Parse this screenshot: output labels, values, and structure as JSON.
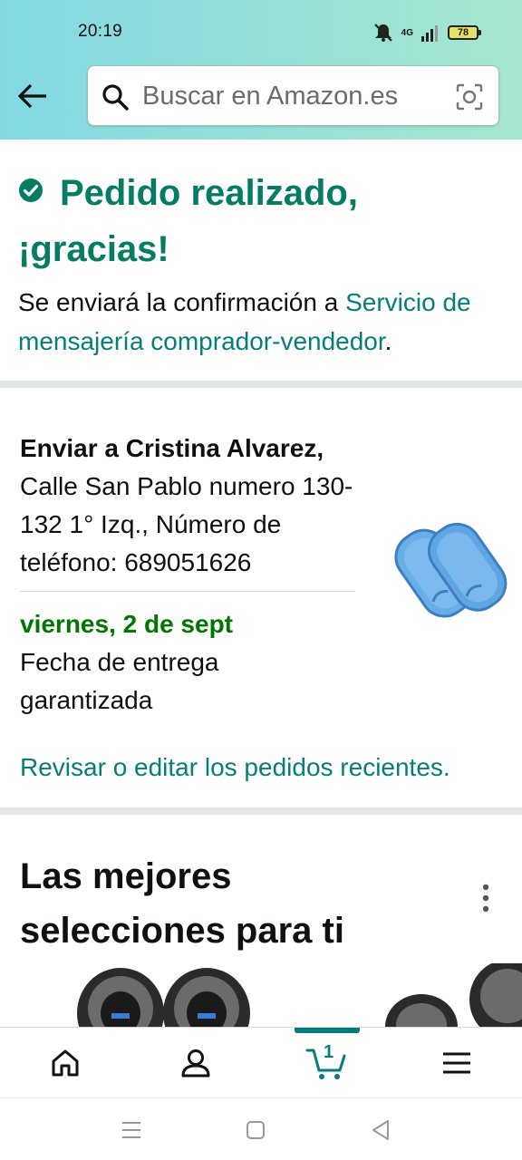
{
  "status_bar": {
    "time": "20:19",
    "network_label": "4G",
    "battery_level": "78",
    "battery_color": "#e6df6a",
    "icons": [
      "mute-icon",
      "signal-icon",
      "battery-icon"
    ]
  },
  "header": {
    "back_icon": "arrow-left-icon",
    "search": {
      "placeholder": "Buscar en Amazon.es",
      "search_icon": "search-icon",
      "camera_icon": "camera-scan-icon"
    },
    "gradient": [
      "#83d9e3",
      "#a6e6ce"
    ]
  },
  "confirmation": {
    "icon": "check-circle-icon",
    "title": "Pedido realizado, ¡gracias!",
    "text_prefix": "Se enviará la confirmación a ",
    "link_text": "Servicio de mensajería comprador-vendedor",
    "text_suffix": ".",
    "title_color": "#067d62",
    "link_color": "#067d7d"
  },
  "shipping": {
    "recipient": "Enviar a Cristina Alvarez,",
    "address": "Calle San Pablo numero 130-132 1° Izq., Número de teléfono: 689051626",
    "delivery_date": "viernes, 2 de sept",
    "delivery_label": "Fecha de entrega garantizada",
    "review_link": "Revisar o editar los pedidos recientes.",
    "date_color": "#007600"
  },
  "recommendations": {
    "title": "Las mejores selecciones para ti",
    "menu_icon": "more-vertical-icon"
  },
  "bottom_nav": {
    "items": [
      {
        "name": "home",
        "icon": "home-icon"
      },
      {
        "name": "account",
        "icon": "user-icon"
      },
      {
        "name": "cart",
        "icon": "cart-icon",
        "count": "1",
        "active": true
      },
      {
        "name": "menu",
        "icon": "hamburger-icon"
      }
    ]
  },
  "system_nav": {
    "items": [
      "recents-icon",
      "home-square-icon",
      "back-triangle-icon"
    ]
  }
}
